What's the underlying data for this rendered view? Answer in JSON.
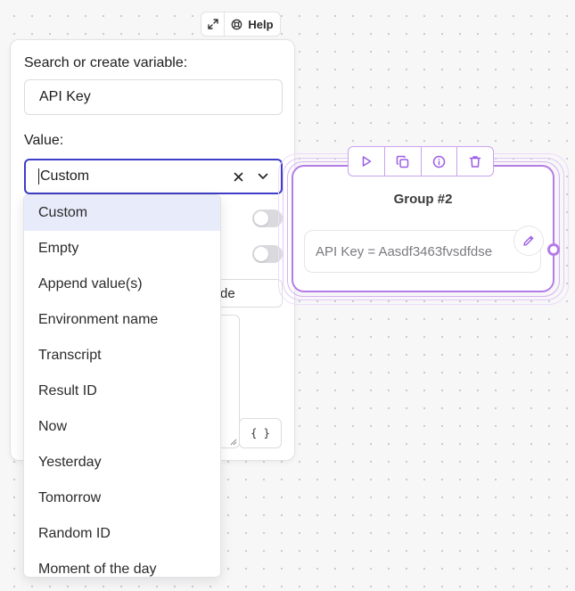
{
  "top_toolbar": {
    "expand_icon": "expand-icon",
    "help_icon": "lifebuoy-icon",
    "help_label": "Help"
  },
  "panel": {
    "search_label": "Search or create variable:",
    "variable_name": "API Key",
    "value_label": "Value:",
    "selected_value": "Custom",
    "partial_input_text": "de",
    "braces_label": "{ }"
  },
  "dropdown": {
    "options": [
      "Custom",
      "Empty",
      "Append value(s)",
      "Environment name",
      "Transcript",
      "Result ID",
      "Now",
      "Yesterday",
      "Tomorrow",
      "Random ID",
      "Moment of the day"
    ],
    "active_index": 0
  },
  "group": {
    "title": "Group #2",
    "block_text": "API Key = Aasdf3463fvsdfdse",
    "toolbar_icons": [
      "play-icon",
      "duplicate-icon",
      "info-icon",
      "trash-icon"
    ],
    "accent_color": "#b57ce8"
  },
  "colors": {
    "focus_border": "#3e3ec8",
    "active_option_bg": "#e8ebfa"
  }
}
